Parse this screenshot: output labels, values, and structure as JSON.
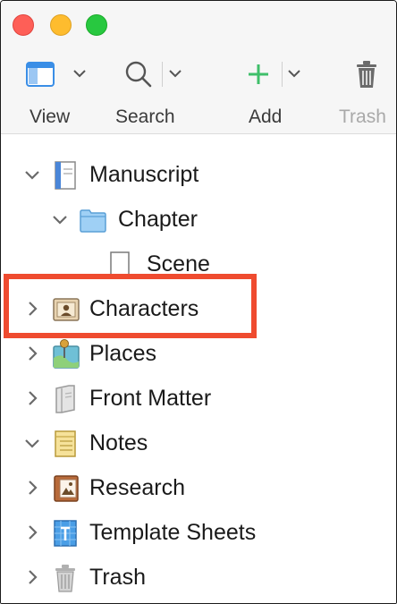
{
  "toolbar": {
    "view_label": "View",
    "search_label": "Search",
    "add_label": "Add",
    "trash_label": "Trash"
  },
  "binder": [
    {
      "label": "Manuscript",
      "icon": "manuscript-icon",
      "expanded": true
    },
    {
      "label": "Chapter",
      "icon": "folder-icon",
      "expanded": true
    },
    {
      "label": "Scene",
      "icon": "document-icon"
    },
    {
      "label": "Characters",
      "icon": "character-card-icon",
      "expanded": false,
      "highlighted": true
    },
    {
      "label": "Places",
      "icon": "map-pin-icon",
      "expanded": false
    },
    {
      "label": "Front Matter",
      "icon": "front-matter-icon",
      "expanded": false
    },
    {
      "label": "Notes",
      "icon": "notepad-icon",
      "expanded": true
    },
    {
      "label": "Research",
      "icon": "research-icon",
      "expanded": false
    },
    {
      "label": "Template Sheets",
      "icon": "template-icon",
      "expanded": false
    },
    {
      "label": "Trash",
      "icon": "trash-can-icon",
      "expanded": false
    }
  ],
  "colors": {
    "highlight": "#ef4b2f",
    "add_accent": "#3fbf6a",
    "toolbar_icon": "#3a8ee6"
  }
}
